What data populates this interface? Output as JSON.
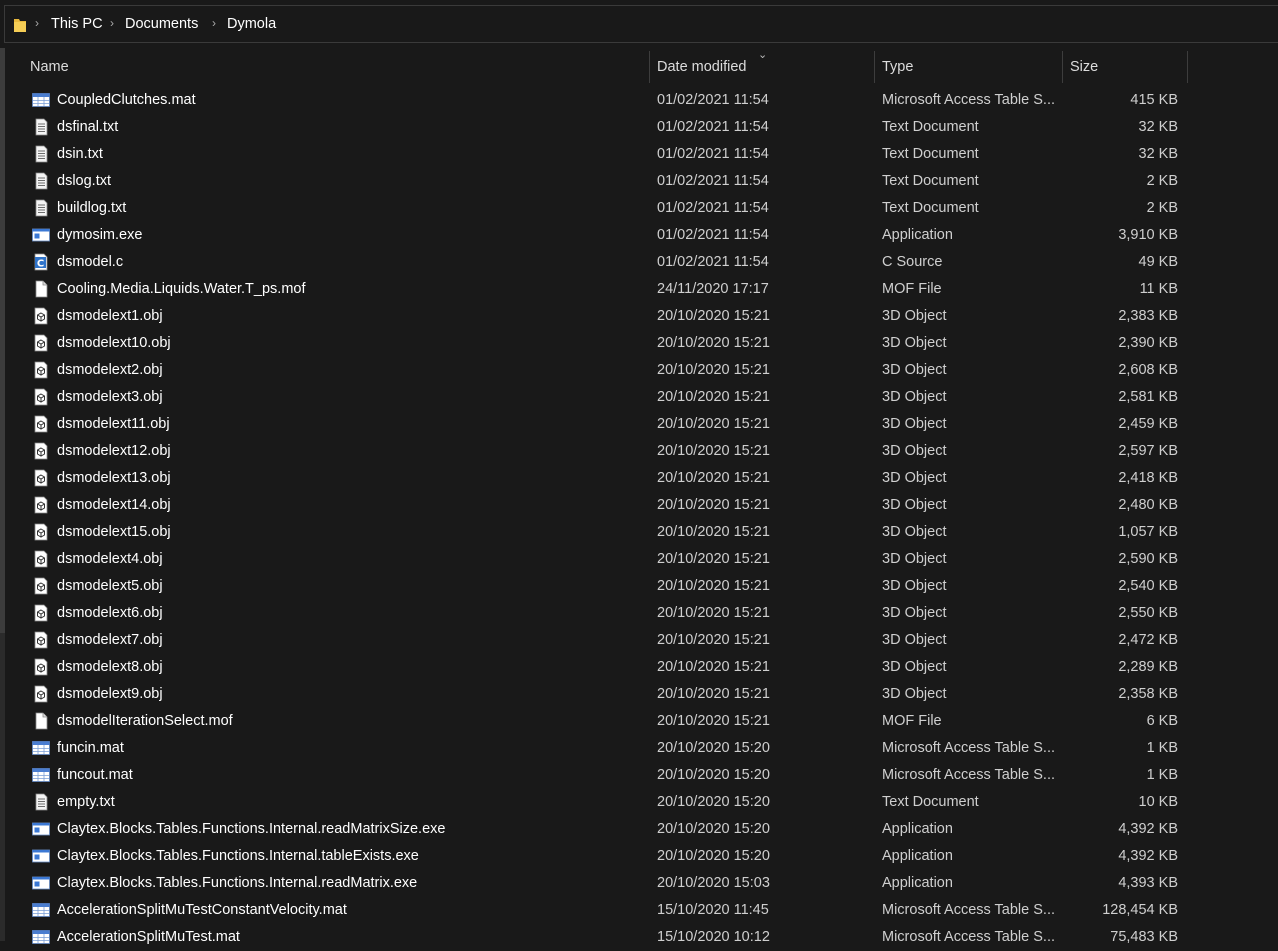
{
  "breadcrumb": {
    "items": [
      "This PC",
      "Documents",
      "Dymola"
    ],
    "separator": "›"
  },
  "columns": {
    "name": "Name",
    "date": "Date modified",
    "type": "Type",
    "size": "Size"
  },
  "files": [
    {
      "name": "CoupledClutches.mat",
      "date": "01/02/2021 11:54",
      "type": "Microsoft Access Table S...",
      "size": "415 KB",
      "icon": "table-file-icon"
    },
    {
      "name": "dsfinal.txt",
      "date": "01/02/2021 11:54",
      "type": "Text Document",
      "size": "32 KB",
      "icon": "text-file-icon"
    },
    {
      "name": "dsin.txt",
      "date": "01/02/2021 11:54",
      "type": "Text Document",
      "size": "32 KB",
      "icon": "text-file-icon"
    },
    {
      "name": "dslog.txt",
      "date": "01/02/2021 11:54",
      "type": "Text Document",
      "size": "2 KB",
      "icon": "text-file-icon"
    },
    {
      "name": "buildlog.txt",
      "date": "01/02/2021 11:54",
      "type": "Text Document",
      "size": "2 KB",
      "icon": "text-file-icon"
    },
    {
      "name": "dymosim.exe",
      "date": "01/02/2021 11:54",
      "type": "Application",
      "size": "3,910 KB",
      "icon": "application-icon"
    },
    {
      "name": "dsmodel.c",
      "date": "01/02/2021 11:54",
      "type": "C Source",
      "size": "49 KB",
      "icon": "c-source-icon"
    },
    {
      "name": "Cooling.Media.Liquids.Water.T_ps.mof",
      "date": "24/11/2020 17:17",
      "type": "MOF File",
      "size": "11 KB",
      "icon": "blank-file-icon"
    },
    {
      "name": "dsmodelext1.obj",
      "date": "20/10/2020 15:21",
      "type": "3D Object",
      "size": "2,383 KB",
      "icon": "3d-object-icon"
    },
    {
      "name": "dsmodelext10.obj",
      "date": "20/10/2020 15:21",
      "type": "3D Object",
      "size": "2,390 KB",
      "icon": "3d-object-icon"
    },
    {
      "name": "dsmodelext2.obj",
      "date": "20/10/2020 15:21",
      "type": "3D Object",
      "size": "2,608 KB",
      "icon": "3d-object-icon"
    },
    {
      "name": "dsmodelext3.obj",
      "date": "20/10/2020 15:21",
      "type": "3D Object",
      "size": "2,581 KB",
      "icon": "3d-object-icon"
    },
    {
      "name": "dsmodelext11.obj",
      "date": "20/10/2020 15:21",
      "type": "3D Object",
      "size": "2,459 KB",
      "icon": "3d-object-icon"
    },
    {
      "name": "dsmodelext12.obj",
      "date": "20/10/2020 15:21",
      "type": "3D Object",
      "size": "2,597 KB",
      "icon": "3d-object-icon"
    },
    {
      "name": "dsmodelext13.obj",
      "date": "20/10/2020 15:21",
      "type": "3D Object",
      "size": "2,418 KB",
      "icon": "3d-object-icon"
    },
    {
      "name": "dsmodelext14.obj",
      "date": "20/10/2020 15:21",
      "type": "3D Object",
      "size": "2,480 KB",
      "icon": "3d-object-icon"
    },
    {
      "name": "dsmodelext15.obj",
      "date": "20/10/2020 15:21",
      "type": "3D Object",
      "size": "1,057 KB",
      "icon": "3d-object-icon"
    },
    {
      "name": "dsmodelext4.obj",
      "date": "20/10/2020 15:21",
      "type": "3D Object",
      "size": "2,590 KB",
      "icon": "3d-object-icon"
    },
    {
      "name": "dsmodelext5.obj",
      "date": "20/10/2020 15:21",
      "type": "3D Object",
      "size": "2,540 KB",
      "icon": "3d-object-icon"
    },
    {
      "name": "dsmodelext6.obj",
      "date": "20/10/2020 15:21",
      "type": "3D Object",
      "size": "2,550 KB",
      "icon": "3d-object-icon"
    },
    {
      "name": "dsmodelext7.obj",
      "date": "20/10/2020 15:21",
      "type": "3D Object",
      "size": "2,472 KB",
      "icon": "3d-object-icon"
    },
    {
      "name": "dsmodelext8.obj",
      "date": "20/10/2020 15:21",
      "type": "3D Object",
      "size": "2,289 KB",
      "icon": "3d-object-icon"
    },
    {
      "name": "dsmodelext9.obj",
      "date": "20/10/2020 15:21",
      "type": "3D Object",
      "size": "2,358 KB",
      "icon": "3d-object-icon"
    },
    {
      "name": "dsmodelIterationSelect.mof",
      "date": "20/10/2020 15:21",
      "type": "MOF File",
      "size": "6 KB",
      "icon": "blank-file-icon"
    },
    {
      "name": "funcin.mat",
      "date": "20/10/2020 15:20",
      "type": "Microsoft Access Table S...",
      "size": "1 KB",
      "icon": "table-file-icon"
    },
    {
      "name": "funcout.mat",
      "date": "20/10/2020 15:20",
      "type": "Microsoft Access Table S...",
      "size": "1 KB",
      "icon": "table-file-icon"
    },
    {
      "name": "empty.txt",
      "date": "20/10/2020 15:20",
      "type": "Text Document",
      "size": "10 KB",
      "icon": "text-file-icon"
    },
    {
      "name": "Claytex.Blocks.Tables.Functions.Internal.readMatrixSize.exe",
      "date": "20/10/2020 15:20",
      "type": "Application",
      "size": "4,392 KB",
      "icon": "application-icon"
    },
    {
      "name": "Claytex.Blocks.Tables.Functions.Internal.tableExists.exe",
      "date": "20/10/2020 15:20",
      "type": "Application",
      "size": "4,392 KB",
      "icon": "application-icon"
    },
    {
      "name": "Claytex.Blocks.Tables.Functions.Internal.readMatrix.exe",
      "date": "20/10/2020 15:03",
      "type": "Application",
      "size": "4,393 KB",
      "icon": "application-icon"
    },
    {
      "name": "AccelerationSplitMuTestConstantVelocity.mat",
      "date": "15/10/2020 11:45",
      "type": "Microsoft Access Table S...",
      "size": "128,454 KB",
      "icon": "table-file-icon"
    },
    {
      "name": "AccelerationSplitMuTest.mat",
      "date": "15/10/2020 10:12",
      "type": "Microsoft Access Table S...",
      "size": "75,483 KB",
      "icon": "table-file-icon"
    }
  ]
}
